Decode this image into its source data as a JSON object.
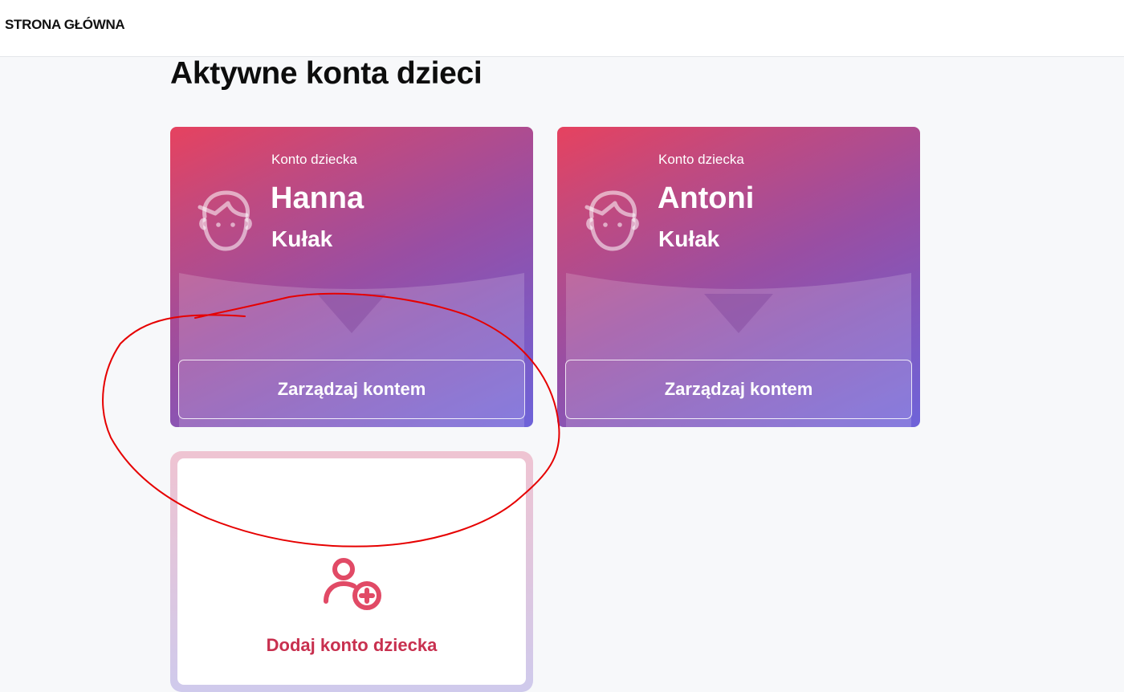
{
  "header": {
    "home_link": "STRONA GŁÓWNA"
  },
  "main": {
    "title": "Aktywne konta dzieci",
    "children": [
      {
        "caption": "Konto dziecka",
        "first_name": "Hanna",
        "last_name": "Kułak",
        "button_label": "Zarządzaj kontem"
      },
      {
        "caption": "Konto dziecka",
        "first_name": "Antoni",
        "last_name": "Kułak",
        "button_label": "Zarządzaj kontem"
      }
    ],
    "add_child": {
      "label": "Dodaj konto dziecka"
    }
  },
  "icons": {
    "child_avatar": "child-face-icon",
    "add_user": "add-user-icon"
  },
  "colors": {
    "card_gradient_start": "#e6425f",
    "card_gradient_end": "#6e63d9",
    "accent_red": "#c8304f",
    "annotation_red": "#e60000"
  }
}
